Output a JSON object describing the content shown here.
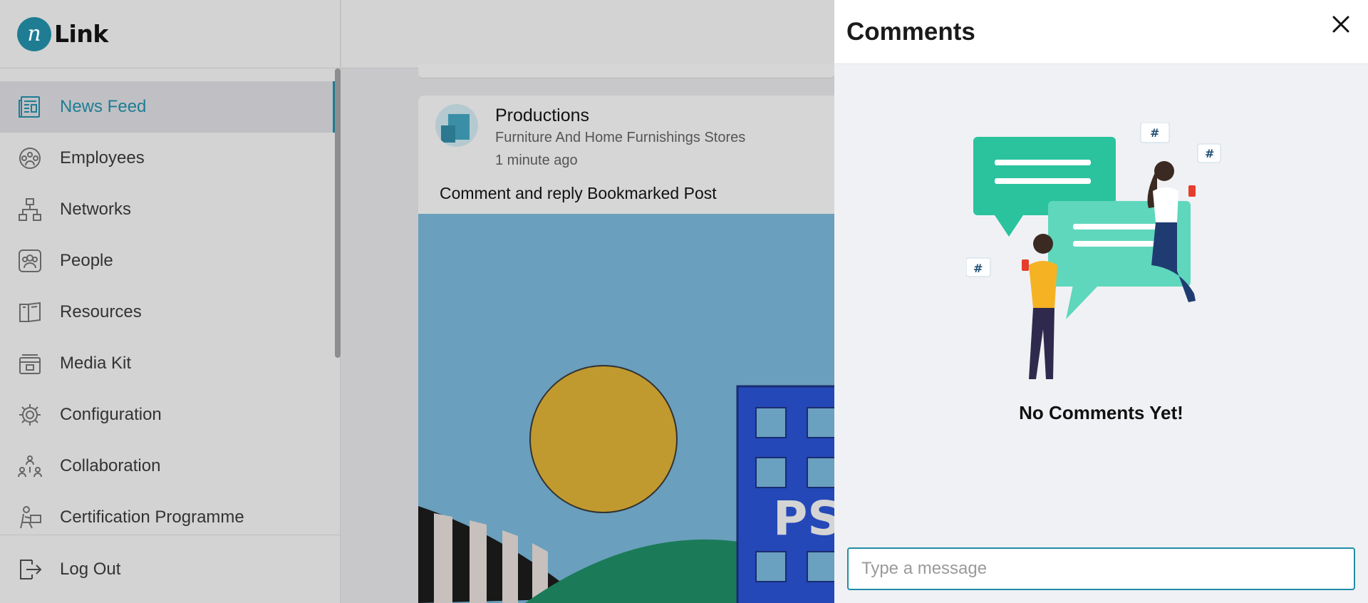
{
  "app": {
    "logo_letter": "n",
    "logo_text": "Link"
  },
  "sidebar": {
    "items": [
      {
        "label": "News Feed",
        "icon": "newspaper-icon",
        "active": true
      },
      {
        "label": "Employees",
        "icon": "employees-icon"
      },
      {
        "label": "Networks",
        "icon": "network-icon"
      },
      {
        "label": "People",
        "icon": "people-icon"
      },
      {
        "label": "Resources",
        "icon": "book-icon"
      },
      {
        "label": "Media Kit",
        "icon": "media-kit-icon"
      },
      {
        "label": "Configuration",
        "icon": "gear-icon"
      },
      {
        "label": "Collaboration",
        "icon": "collaboration-icon"
      },
      {
        "label": "Certification Programme",
        "icon": "certificate-icon"
      }
    ],
    "logout": {
      "label": "Log Out",
      "icon": "logout-icon"
    }
  },
  "post": {
    "author": "Productions",
    "subtitle": "Furniture And Home Furnishings Stores",
    "time": "1 minute ago",
    "text": "Comment and reply Bookmarked Post",
    "image_text": "PS"
  },
  "comments": {
    "title": "Comments",
    "empty_text": "No Comments Yet!",
    "input_placeholder": "Type a message"
  },
  "colors": {
    "accent": "#1e7d93",
    "sidebar_bg": "#d3d3d3",
    "panel_bg": "#f0f1f4",
    "input_border": "#1e8ea8"
  }
}
